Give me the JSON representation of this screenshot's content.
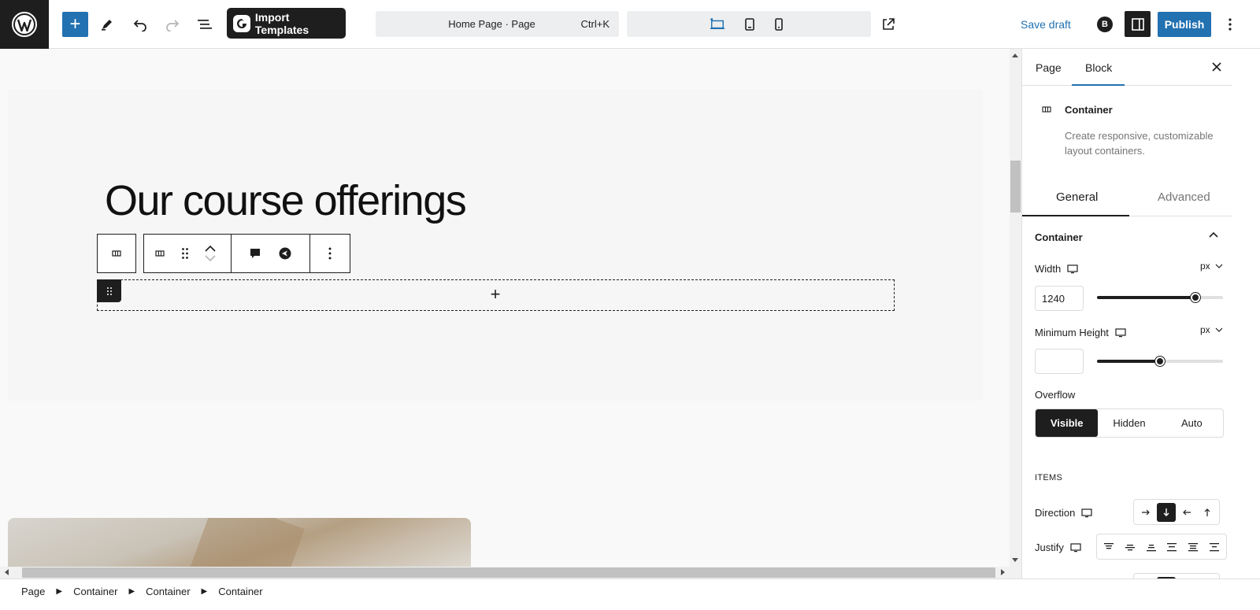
{
  "topbar": {
    "import_templates": "Import Templates",
    "document_title": "Home Page · Page",
    "shortcut": "Ctrl+K",
    "save_draft": "Save draft",
    "brand_letter": "B",
    "publish": "Publish"
  },
  "canvas": {
    "heading": "Our course offerings"
  },
  "breadcrumb": [
    "Page",
    "Container",
    "Container",
    "Container"
  ],
  "inspector": {
    "tabs": [
      "Page",
      "Block"
    ],
    "active_tab": "Block",
    "block_title": "Container",
    "block_description": "Create responsive, customizable layout containers.",
    "sub_tabs": [
      "General",
      "Advanced"
    ],
    "active_sub_tab": "General",
    "panel_title": "Container",
    "width_label": "Width",
    "width_value": "1240",
    "width_unit": "px",
    "width_slider_level": 0.78,
    "min_height_label": "Minimum Height",
    "min_height_value": "",
    "min_height_unit": "px",
    "min_height_slider_level": 0.5,
    "overflow_label": "Overflow",
    "overflow_options": [
      "Visible",
      "Hidden",
      "Auto"
    ],
    "overflow_selected": "Visible",
    "items_title": "ITEMS",
    "direction_label": "Direction",
    "direction_selected": "column",
    "justify_label": "Justify"
  },
  "colors": {
    "accent": "#2271b1",
    "dark": "#1e1e1e"
  }
}
